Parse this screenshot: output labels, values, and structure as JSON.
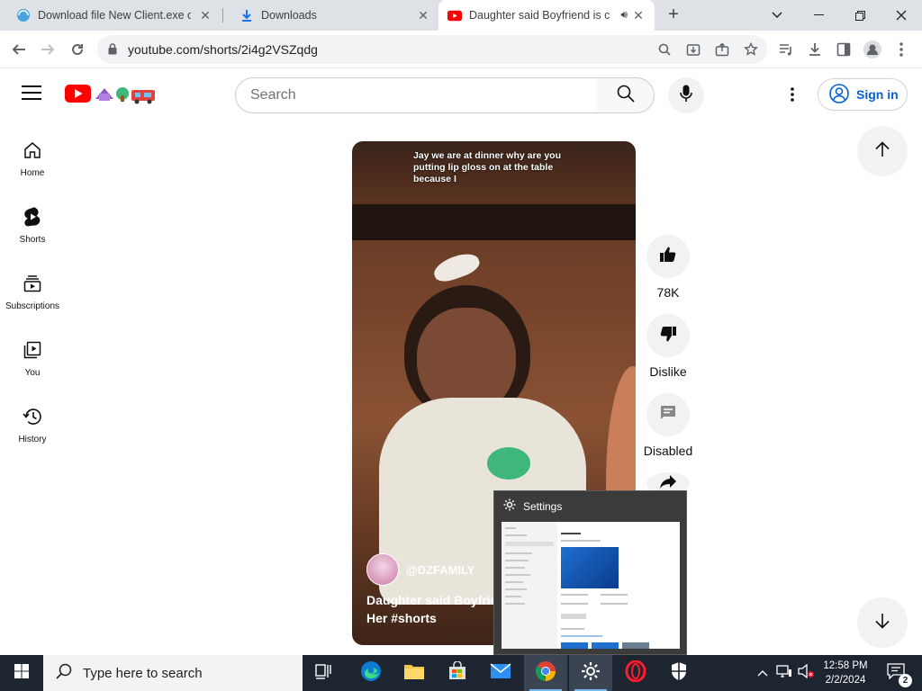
{
  "browser": {
    "tabs": [
      {
        "title": "Download file New Client.exe on",
        "favicon": "globe-icon"
      },
      {
        "title": "Downloads",
        "favicon": "download-icon"
      },
      {
        "title": "Daughter said Boyfriend is c",
        "favicon": "youtube-icon",
        "audio": true,
        "active": true
      }
    ],
    "new_tab_label": "+",
    "url": "youtube.com/shorts/2i4g2VSZqdg"
  },
  "youtube": {
    "search_placeholder": "Search",
    "sign_in_label": "Sign in",
    "nav": [
      {
        "label": "Home",
        "icon": "home-icon"
      },
      {
        "label": "Shorts",
        "icon": "shorts-icon"
      },
      {
        "label": "Subscriptions",
        "icon": "subscriptions-icon"
      },
      {
        "label": "You",
        "icon": "you-icon"
      },
      {
        "label": "History",
        "icon": "history-icon"
      }
    ],
    "short": {
      "caption": "Jay we are at dinner why are you putting lip gloss on at the table because I",
      "channel": "@DZFAMILY",
      "title_line1": "Daughter said Boyfriend",
      "title_line2": "Her #shorts"
    },
    "actions": {
      "like_count": "78K",
      "dislike_label": "Dislike",
      "comments_label": "Disabled"
    }
  },
  "thumbnail_popup": {
    "title": "Settings"
  },
  "taskbar": {
    "search_placeholder": "Type here to search",
    "time": "12:58 PM",
    "date": "2/2/2024",
    "notification_count": "2"
  },
  "colors": {
    "youtube_red": "#ff0000",
    "link_blue": "#065fd4",
    "taskbar_bg": "#1c2530"
  }
}
